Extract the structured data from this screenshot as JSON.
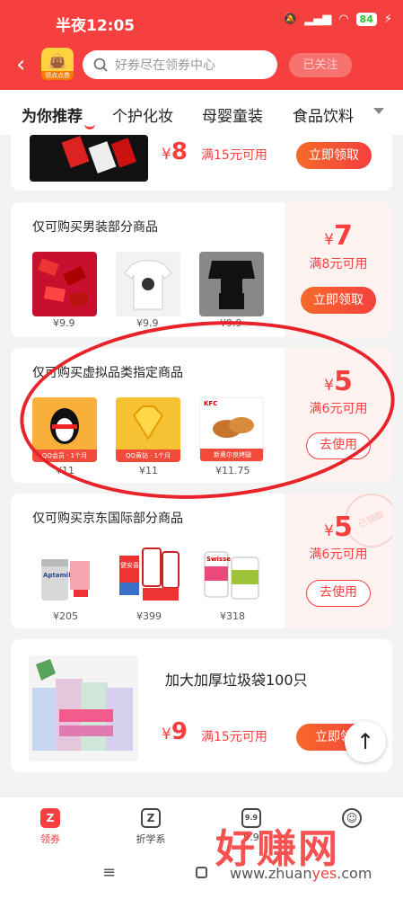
{
  "status": {
    "time": "半夜12:05",
    "battery": "84"
  },
  "header": {
    "logo_caption": "领点点券",
    "search_placeholder": "好券尽在领券中心",
    "follow_label": "已关注"
  },
  "tabs": [
    {
      "label": "为你推荐"
    },
    {
      "label": "个护化妆"
    },
    {
      "label": "母婴童装"
    },
    {
      "label": "食品饮料"
    }
  ],
  "cards": {
    "partial": {
      "yen": "¥",
      "amount": "8",
      "cond": "满15元可用",
      "button": "立即领取"
    },
    "mens": {
      "title": "仅可购买男装部分商品",
      "prices": [
        "¥9.9",
        "¥9.9",
        "¥9.9"
      ],
      "yen": "¥",
      "amount": "7",
      "cond": "满8元可用",
      "button": "立即领取"
    },
    "virtual": {
      "title": "仅可购买虚拟品类指定商品",
      "items": [
        {
          "caption": "QQ会员 · 1个月",
          "price": "¥11"
        },
        {
          "caption": "QQ黄钻 · 1个月",
          "price": "¥11"
        },
        {
          "caption": "新奥尔良烤翅",
          "price": "¥11.75"
        }
      ],
      "kfc": "KFC",
      "yen": "¥",
      "amount": "5",
      "cond": "满6元可用",
      "button": "去使用"
    },
    "jd": {
      "title": "仅可购买京东国际部分商品",
      "items": [
        {
          "label": "Aptamil",
          "price": "¥205"
        },
        {
          "label": "健安喜",
          "price": "¥399"
        },
        {
          "label": "Swisse",
          "price": "¥318"
        }
      ],
      "stamp": "已领取",
      "yen": "¥",
      "amount": "5",
      "cond": "满6元可用",
      "button": "去使用"
    },
    "bags": {
      "title": "加大加厚垃圾袋100只",
      "yen": "¥",
      "amount": "9",
      "cond": "满15元可用",
      "button": "立即领"
    }
  },
  "bottom_nav": [
    {
      "label": "领券",
      "glyph": "Z"
    },
    {
      "label": "折学系",
      "glyph": "Z"
    },
    {
      "label": "9.9",
      "glyph": "9.9"
    },
    {
      "label": "",
      "glyph": "☺"
    }
  ],
  "watermark": {
    "text": "好赚网",
    "url_a": "www.zhuan",
    "url_b": "yes",
    "url_c": ".com"
  }
}
